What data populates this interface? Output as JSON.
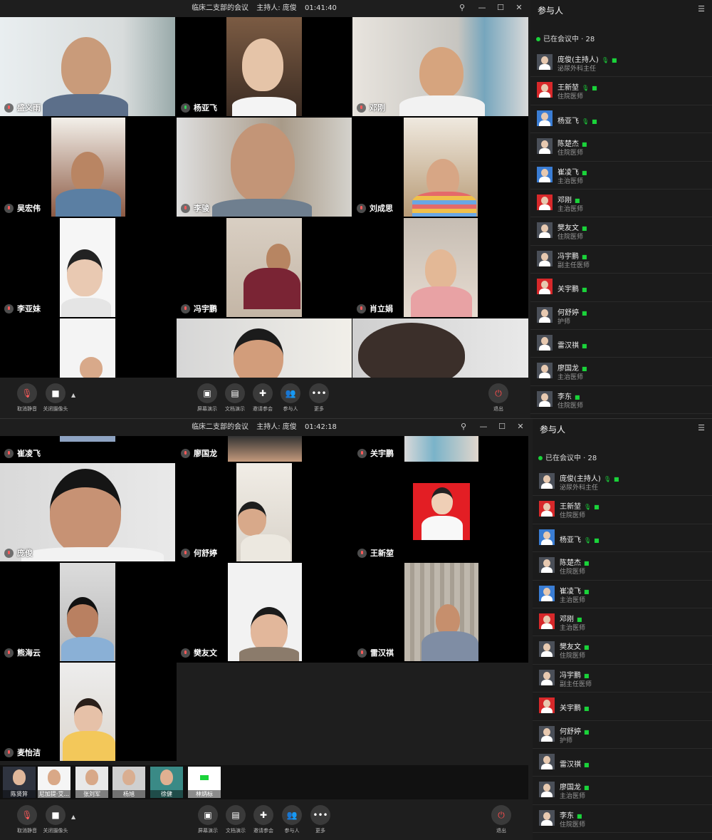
{
  "meetings": [
    {
      "title": "临床二支部的会议",
      "host_label": "主持人: 庞俊",
      "time": "01:41:40",
      "tiles": [
        "盛义雨",
        "杨亚飞",
        "邓刚",
        "吴宏伟",
        "李骏",
        "刘成思",
        "李亚妹",
        "冯宇鹏",
        "肖立娟"
      ],
      "toolbar": [
        "取消静音",
        "关闭摄像头",
        "屏幕演示",
        "文档演示",
        "邀请参会",
        "参与人",
        "更多",
        "退出"
      ],
      "panel": {
        "title": "参与人",
        "count": "已在会议中 · 28"
      }
    },
    {
      "title": "临床二支部的会议",
      "host_label": "主持人: 庞俊",
      "time": "01:42:18",
      "tiles": [
        "崔凌飞",
        "廖国龙",
        "关宇鹏",
        "庞俊",
        "何舒婷",
        "王新堃",
        "熊海云",
        "樊友文",
        "雷汉祺",
        "麦怡洁"
      ],
      "thumbs": [
        "陈贤笄",
        "尼加提·艾...",
        "张刘军",
        "杨旭",
        "徐健",
        "林炳标"
      ],
      "toolbar": [
        "取消静音",
        "关闭摄像头",
        "屏幕演示",
        "文档演示",
        "邀请参会",
        "参与人",
        "更多",
        "退出"
      ],
      "panel": {
        "title": "参与人",
        "count": "已在会议中 · 28"
      }
    }
  ],
  "participants": [
    {
      "name": "庞俊(主持人)",
      "role": "泌尿外科主任",
      "mic": true,
      "cam": true
    },
    {
      "name": "王新堃",
      "role": "住院医师",
      "mic": true,
      "cam": true
    },
    {
      "name": "杨亚飞",
      "role": "",
      "mic": true,
      "cam": true
    },
    {
      "name": "陈楚杰",
      "role": "住院医师",
      "mic": false,
      "cam": true
    },
    {
      "name": "崔凌飞",
      "role": "主治医师",
      "mic": false,
      "cam": true
    },
    {
      "name": "邓刚",
      "role": "主治医师",
      "mic": false,
      "cam": true
    },
    {
      "name": "樊友文",
      "role": "住院医师",
      "mic": false,
      "cam": true
    },
    {
      "name": "冯宇鹏",
      "role": "副主任医师",
      "mic": false,
      "cam": true
    },
    {
      "name": "关宇鹏",
      "role": "",
      "mic": false,
      "cam": true
    },
    {
      "name": "何舒婷",
      "role": "护师",
      "mic": false,
      "cam": true
    },
    {
      "name": "雷汉祺",
      "role": "",
      "mic": false,
      "cam": true
    },
    {
      "name": "廖国龙",
      "role": "主治医师",
      "mic": false,
      "cam": true
    },
    {
      "name": "李东",
      "role": "住院医师",
      "mic": false,
      "cam": true
    }
  ],
  "colors": {
    "accent_green": "#1ad33a",
    "muted_red": "#ff5a5a",
    "background": "#1e1e1e"
  }
}
